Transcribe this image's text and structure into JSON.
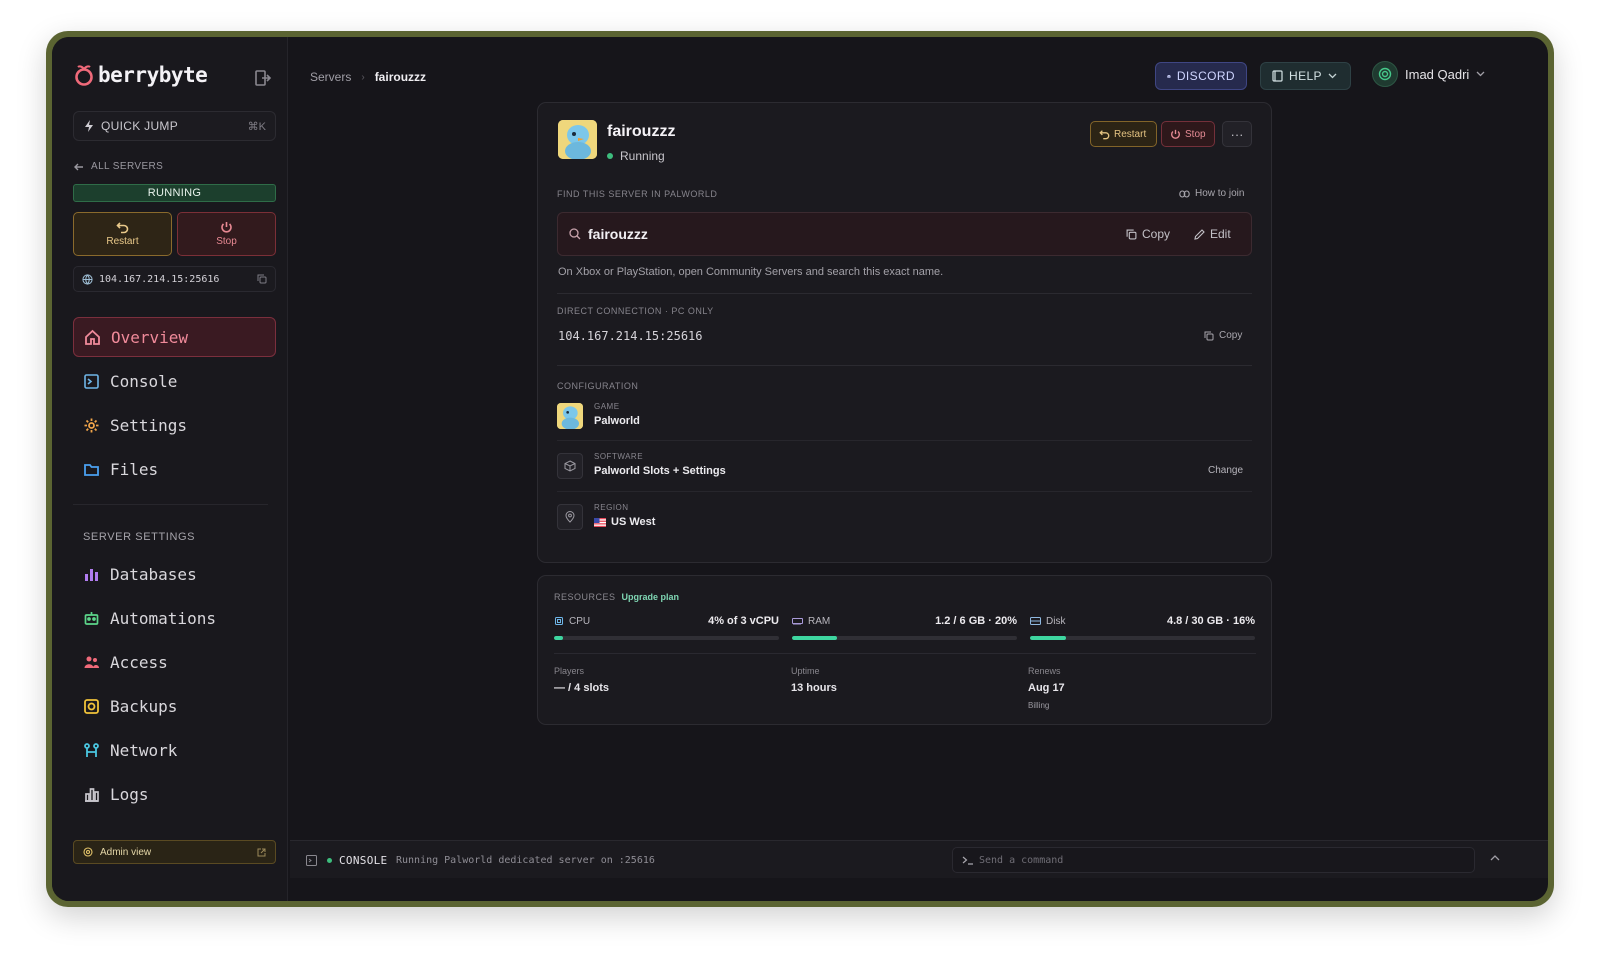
{
  "brand": {
    "name": "berrybyte"
  },
  "sidebar": {
    "quick_jump": {
      "label": "QUICK JUMP",
      "shortcut": "⌘K"
    },
    "all_servers": "ALL SERVERS",
    "status": "RUNNING",
    "restart_label": "Restart",
    "stop_label": "Stop",
    "address": "104.167.214.15:25616",
    "nav": [
      {
        "label": "Overview",
        "icon": "home-icon",
        "color": "#f08a9a"
      },
      {
        "label": "Console",
        "icon": "terminal-icon",
        "color": "#6fb6e8"
      },
      {
        "label": "Settings",
        "icon": "gear-icon",
        "color": "#f0a44a"
      },
      {
        "label": "Files",
        "icon": "folder-icon",
        "color": "#4aa0f0"
      }
    ],
    "section_title": "SERVER SETTINGS",
    "nav2": [
      {
        "label": "Databases",
        "icon": "database-icon",
        "color": "#b17cf0"
      },
      {
        "label": "Automations",
        "icon": "robot-icon",
        "color": "#5cd68a"
      },
      {
        "label": "Access",
        "icon": "users-icon",
        "color": "#f06a7a"
      },
      {
        "label": "Backups",
        "icon": "backup-icon",
        "color": "#f0c23a"
      },
      {
        "label": "Network",
        "icon": "network-icon",
        "color": "#4ac6e0"
      },
      {
        "label": "Logs",
        "icon": "chart-icon",
        "color": "#c8c6cc"
      }
    ],
    "admin_view": "Admin view"
  },
  "header": {
    "breadcrumb": [
      "Servers",
      "fairouzzz"
    ],
    "discord": "DISCORD",
    "help": "HELP",
    "user": "Imad Qadri"
  },
  "server": {
    "name": "fairouzzz",
    "status": "Running",
    "restart_label": "Restart",
    "stop_label": "Stop",
    "find_label": "FIND THIS SERVER IN PALWORLD",
    "how_to_join": "How to join",
    "search_name": "fairouzzz",
    "copy_label": "Copy",
    "edit_label": "Edit",
    "hint": "On Xbox or PlayStation, open Community Servers and search this exact name.",
    "direct_label": "DIRECT CONNECTION · PC ONLY",
    "direct_ip": "104.167.214.15:25616",
    "direct_copy": "Copy",
    "config_label": "CONFIGURATION",
    "config": [
      {
        "key": "GAME",
        "value": "Palworld"
      },
      {
        "key": "SOFTWARE",
        "value": "Palworld Slots + Settings",
        "action": "Change"
      },
      {
        "key": "REGION",
        "value": "US West",
        "flag": "🇺🇸"
      }
    ]
  },
  "resources": {
    "label": "RESOURCES",
    "upgrade": "Upgrade plan",
    "meters": [
      {
        "name": "CPU",
        "value": "4% of 3 vCPU",
        "fill": 0.04
      },
      {
        "name": "RAM",
        "value": "1.2 / 6 GB · 20%",
        "fill": 0.2
      },
      {
        "name": "Disk",
        "value": "4.8 / 30 GB · 16%",
        "fill": 0.16
      }
    ],
    "stats": [
      {
        "key": "Players",
        "value": "— / 4 slots"
      },
      {
        "key": "Uptime",
        "value": "13 hours"
      },
      {
        "key": "Renews",
        "value": "Aug 17",
        "sub": "Billing"
      }
    ]
  },
  "console": {
    "label": "CONSOLE",
    "message": "Running Palworld dedicated server on :25616",
    "placeholder": "Send a command"
  }
}
